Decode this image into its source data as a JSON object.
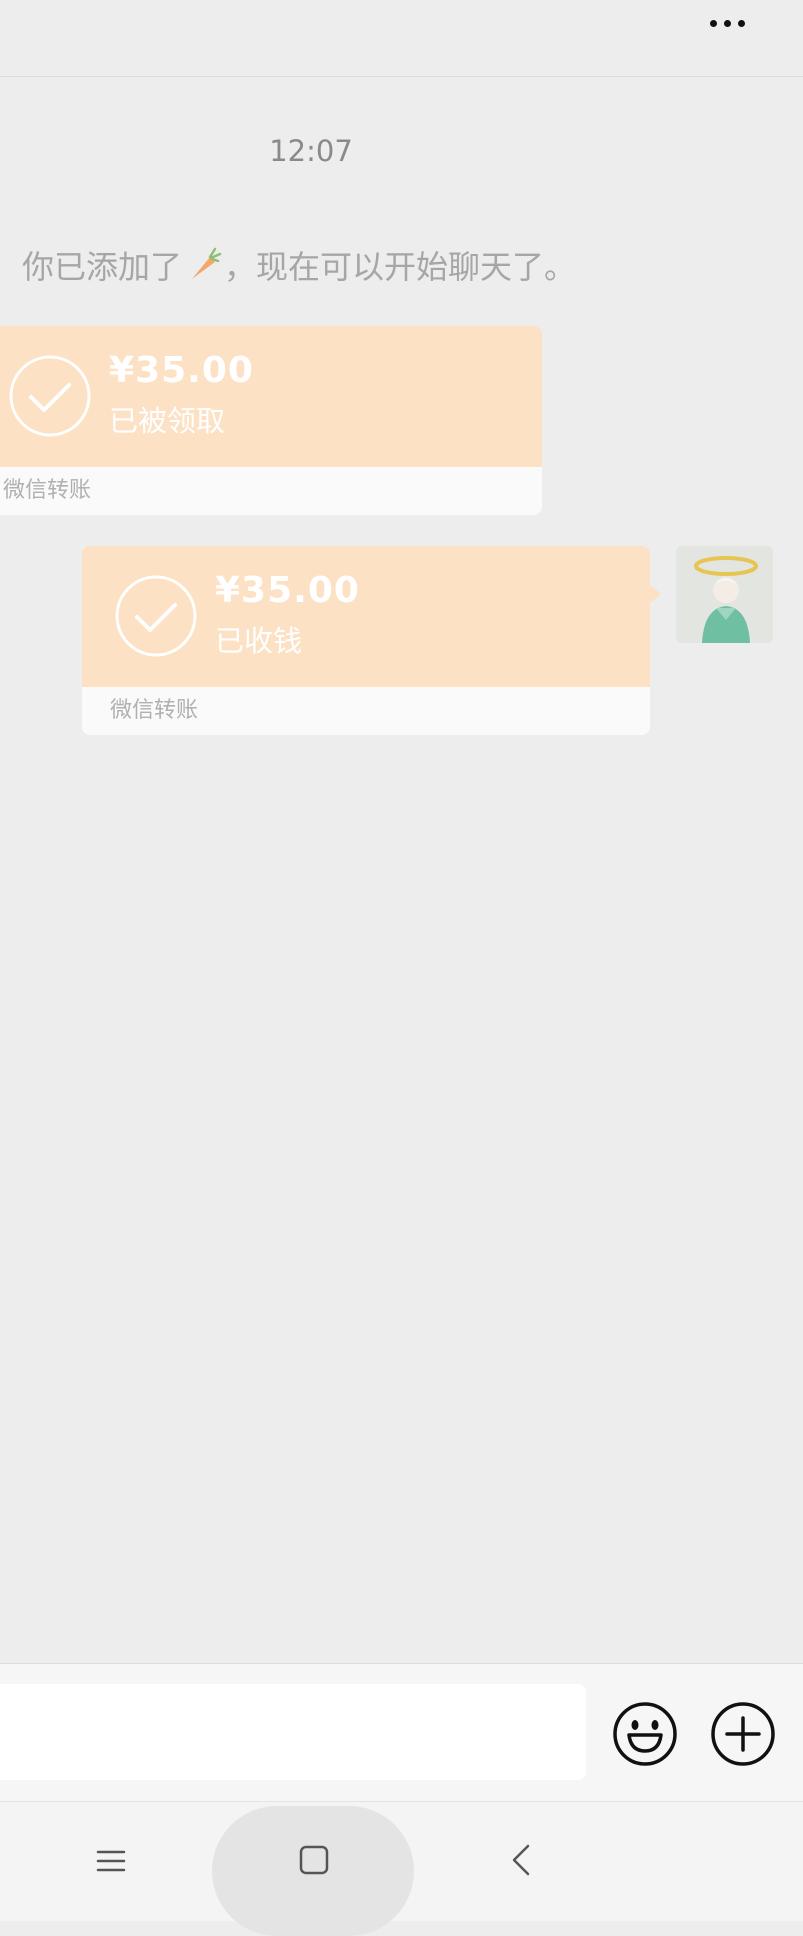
{
  "header": {
    "more_icon": "more-horizontal-icon"
  },
  "chat": {
    "timestamp": "12:07",
    "system_message": {
      "before": "你已添加了",
      "after": "，现在可以开始聊天了。",
      "emoji": "carrot-emoji"
    },
    "transfers": [
      {
        "amount": "¥35.00",
        "status": "已被领取",
        "footer": "微信转账",
        "direction": "incoming"
      },
      {
        "amount": "¥35.00",
        "status": "已收钱",
        "footer": "微信转账",
        "direction": "outgoing"
      }
    ]
  },
  "input_bar": {
    "placeholder": "",
    "emoji_icon": "emoji-smile-icon",
    "plus_icon": "plus-circle-icon"
  },
  "system_nav": {
    "menu_icon": "menu-icon",
    "home_icon": "home-square-icon",
    "back_icon": "back-chevron-icon"
  },
  "colors": {
    "transfer_bg": "#fce1c4",
    "chat_bg": "#ededed"
  }
}
